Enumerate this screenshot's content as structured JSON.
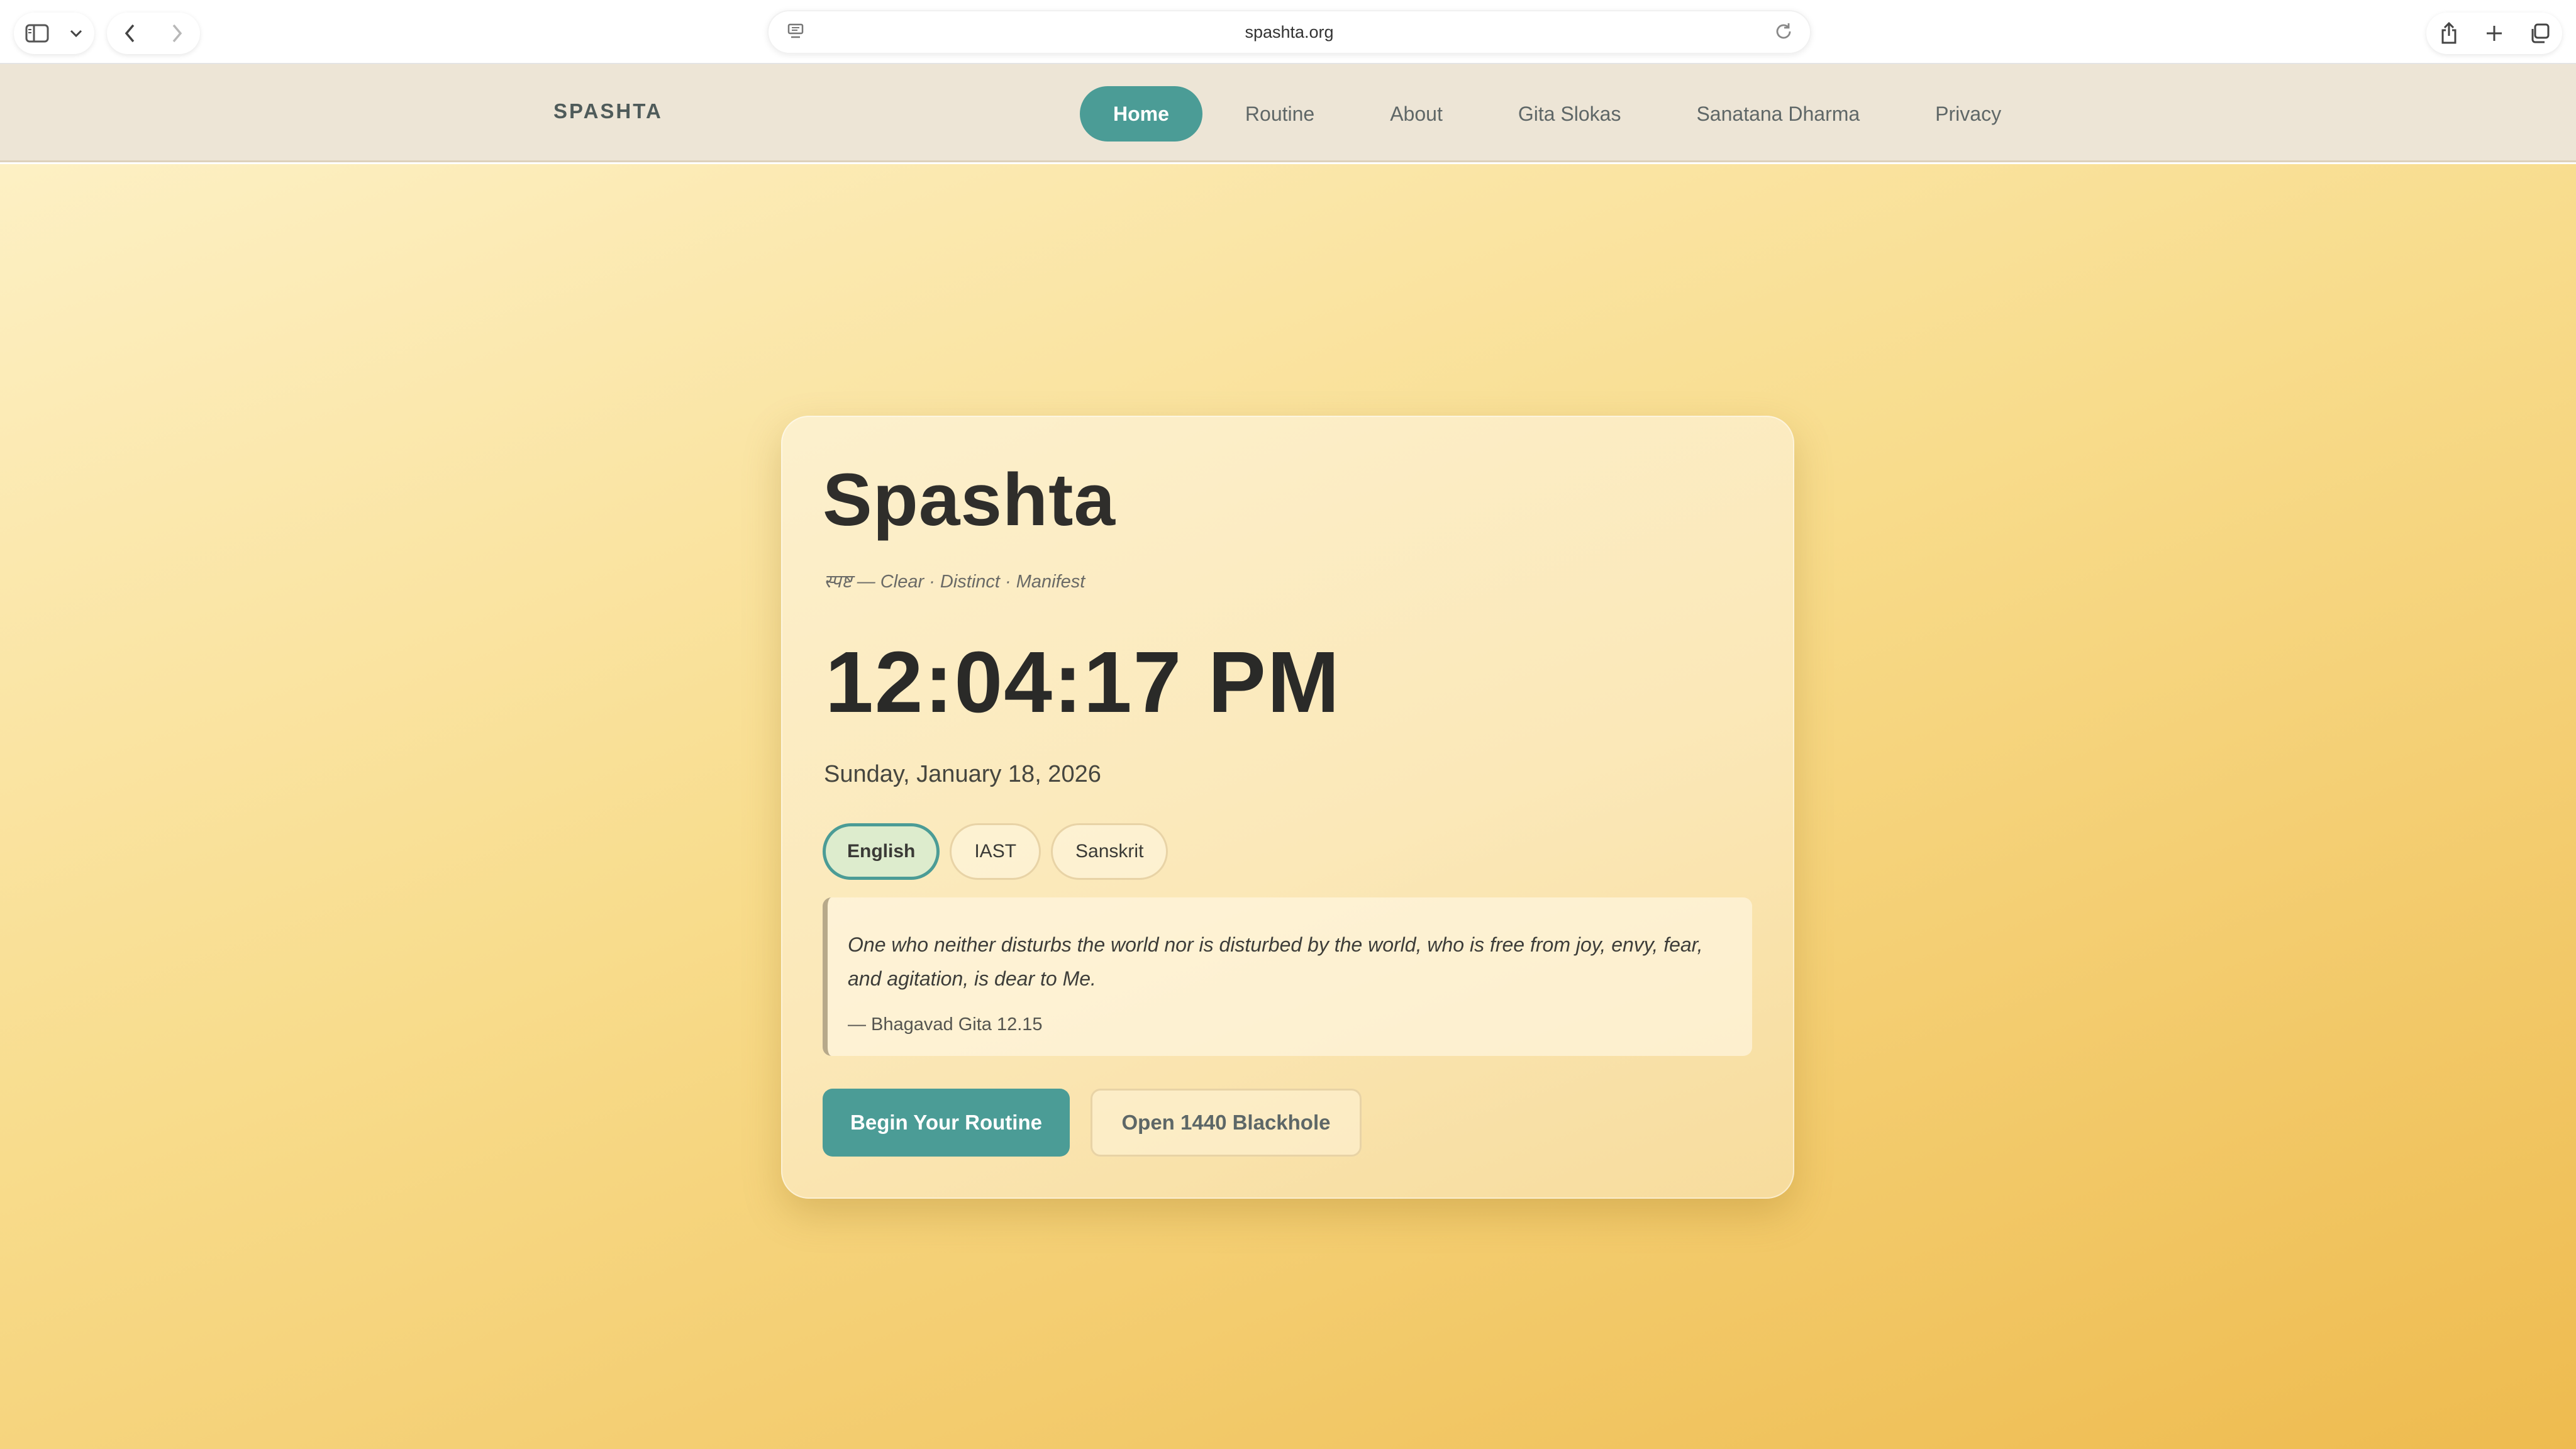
{
  "browser": {
    "url": "spashta.org",
    "icons": [
      "sidebar-icon",
      "chevron-down-icon",
      "back-icon",
      "forward-icon",
      "page-settings-icon",
      "reload-icon",
      "share-icon",
      "new-tab-icon",
      "tab-overview-icon"
    ]
  },
  "nav": {
    "brand": "SPASHTA",
    "links": [
      {
        "label": "Home",
        "active": true
      },
      {
        "label": "Routine",
        "active": false
      },
      {
        "label": "About",
        "active": false
      },
      {
        "label": "Gita Slokas",
        "active": false
      },
      {
        "label": "Sanatana Dharma",
        "active": false
      },
      {
        "label": "Privacy",
        "active": false
      }
    ]
  },
  "hero": {
    "title": "Spashta",
    "subtitle": "स्पष्ट — Clear · Distinct · Manifest",
    "time": "12:04:17 PM",
    "date": "Sunday, January 18, 2026",
    "languages": [
      {
        "label": "English",
        "active": true
      },
      {
        "label": "IAST",
        "active": false
      },
      {
        "label": "Sanskrit",
        "active": false
      }
    ],
    "quote": {
      "text": "One who neither disturbs the world nor is disturbed by the world, who is free from joy, envy, fear, and agitation, is dear to Me.",
      "source": "— Bhagavad Gita 12.15"
    },
    "primary_button": "Begin Your Routine",
    "secondary_button": "Open 1440 Blackhole"
  },
  "colors": {
    "accent": "#4b9c96",
    "nav_background": "#ede5d6",
    "background_start": "#fdf0c4",
    "background_end": "#eebb4f",
    "text_dark": "#2f2e2b"
  }
}
